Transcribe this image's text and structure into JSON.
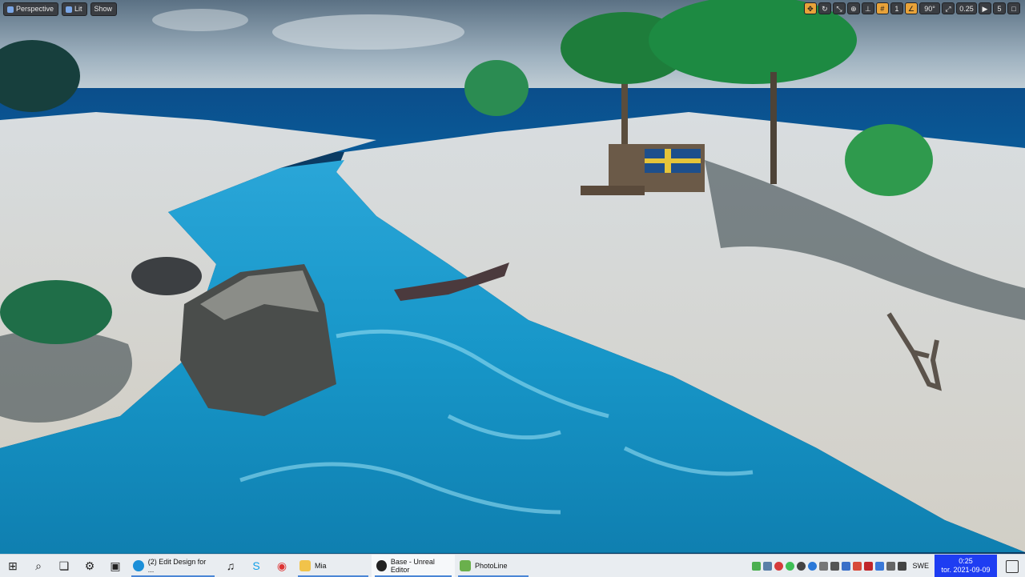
{
  "viewport": {
    "perspective_label": "Perspective",
    "lit_label": "Lit",
    "show_label": "Show",
    "fov_label": "90°",
    "scale_label": "0.25",
    "camera_speed_label": "5",
    "grid_snap_label": "1"
  },
  "taskbar": {
    "apps": [
      {
        "label": "(2) Edit Design for ...",
        "icon": "edge-icon"
      },
      {
        "label": "Mia",
        "icon": "folder-icon"
      },
      {
        "label": "Base - Unreal Editor",
        "icon": "unreal-icon"
      },
      {
        "label": "PhotoLine",
        "icon": "photoline-icon"
      }
    ],
    "language": "SWE",
    "time": "0:25",
    "date": "tor. 2021-09-09"
  }
}
